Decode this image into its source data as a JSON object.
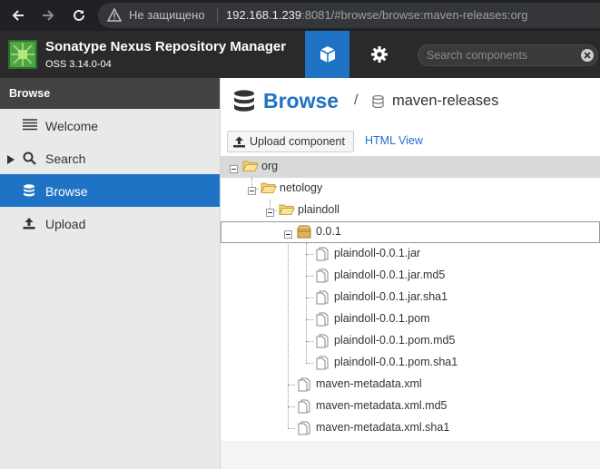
{
  "browser": {
    "security_label": "Не защищено",
    "url_host": "192.168.1.239",
    "url_rest": ":8081/#browse/browse:maven-releases:org"
  },
  "app": {
    "title": "Sonatype Nexus Repository Manager",
    "version": "OSS 3.14.0-04",
    "search_placeholder": "Search components"
  },
  "sidebar": {
    "heading": "Browse",
    "items": [
      {
        "label": "Welcome",
        "icon": "list-icon",
        "active": false
      },
      {
        "label": "Search",
        "icon": "search-icon",
        "active": false
      },
      {
        "label": "Browse",
        "icon": "database-icon",
        "active": true
      },
      {
        "label": "Upload",
        "icon": "upload-icon",
        "active": false
      }
    ]
  },
  "breadcrumb": {
    "title": "Browse",
    "separator": "/",
    "repository": "maven-releases"
  },
  "toolbar": {
    "upload_label": "Upload component",
    "html_view_label": "HTML View"
  },
  "tree": [
    {
      "label": "org",
      "type": "folder",
      "expanded": true,
      "selected": true
    },
    {
      "label": "netology",
      "type": "folder",
      "expanded": true
    },
    {
      "label": "plaindoll",
      "type": "folder",
      "expanded": true
    },
    {
      "label": "0.0.1",
      "type": "component",
      "expanded": true,
      "focused": true
    },
    {
      "label": "plaindoll-0.0.1.jar",
      "type": "asset"
    },
    {
      "label": "plaindoll-0.0.1.jar.md5",
      "type": "asset"
    },
    {
      "label": "plaindoll-0.0.1.jar.sha1",
      "type": "asset"
    },
    {
      "label": "plaindoll-0.0.1.pom",
      "type": "asset"
    },
    {
      "label": "plaindoll-0.0.1.pom.md5",
      "type": "asset"
    },
    {
      "label": "plaindoll-0.0.1.pom.sha1",
      "type": "asset"
    },
    {
      "label": "maven-metadata.xml",
      "type": "asset"
    },
    {
      "label": "maven-metadata.xml.md5",
      "type": "asset"
    },
    {
      "label": "maven-metadata.xml.sha1",
      "type": "asset"
    }
  ],
  "colors": {
    "accent": "#1f73c4",
    "header_bg": "#2a2a2a",
    "sidebar_bg": "#e9e9e9"
  }
}
